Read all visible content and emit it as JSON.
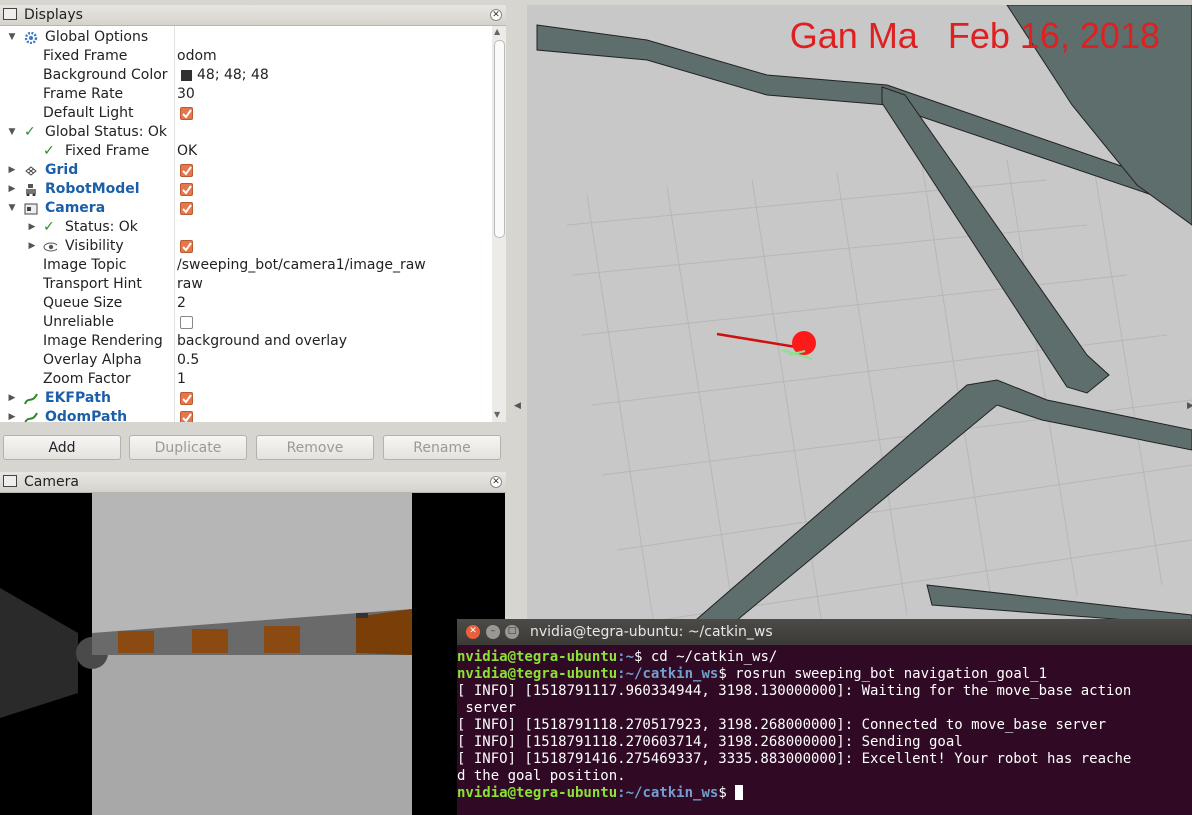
{
  "displays": {
    "title": "Displays",
    "rows": [
      {
        "label": "Global Options"
      },
      {
        "label": "Fixed Frame",
        "value": "odom"
      },
      {
        "label": "Background Color",
        "value": "48; 48; 48"
      },
      {
        "label": "Frame Rate",
        "value": "30"
      },
      {
        "label": "Default Light",
        "checked": true
      },
      {
        "label": "Global Status: Ok"
      },
      {
        "label": "Fixed Frame",
        "value": "OK"
      },
      {
        "label": "Grid",
        "checked": true
      },
      {
        "label": "RobotModel",
        "checked": true
      },
      {
        "label": "Camera",
        "checked": true
      },
      {
        "label": "Status: Ok"
      },
      {
        "label": "Visibility",
        "checked": true
      },
      {
        "label": "Image Topic",
        "value": "/sweeping_bot/camera1/image_raw"
      },
      {
        "label": "Transport Hint",
        "value": "raw"
      },
      {
        "label": "Queue Size",
        "value": "2"
      },
      {
        "label": "Unreliable",
        "checked": false
      },
      {
        "label": "Image Rendering",
        "value": "background and overlay"
      },
      {
        "label": "Overlay Alpha",
        "value": "0.5"
      },
      {
        "label": "Zoom Factor",
        "value": "1"
      },
      {
        "label": "EKFPath",
        "checked": true
      },
      {
        "label": "OdomPath",
        "checked": true
      }
    ]
  },
  "buttons": {
    "add": "Add",
    "duplicate": "Duplicate",
    "remove": "Remove",
    "rename": "Rename"
  },
  "camera_panel": {
    "title": "Camera"
  },
  "view3d": {
    "watermark": "Gan Ma   Feb 16, 2018"
  },
  "terminal": {
    "title": "nvidia@tegra-ubuntu: ~/catkin_ws",
    "lines": [
      {
        "user": "nvidia@tegra-ubuntu",
        "path": ":~",
        "cmd": "$ cd ~/catkin_ws/"
      },
      {
        "user": "nvidia@tegra-ubuntu",
        "path": ":~/catkin_ws",
        "cmd": "$ rosrun sweeping_bot navigation_goal_1"
      },
      {
        "text": "[ INFO] [1518791117.960334944, 3198.130000000]: Waiting for the move_base action"
      },
      {
        "text": " server"
      },
      {
        "text": "[ INFO] [1518791118.270517923, 3198.268000000]: Connected to move_base server"
      },
      {
        "text": "[ INFO] [1518791118.270603714, 3198.268000000]: Sending goal"
      },
      {
        "text": "[ INFO] [1518791416.275469337, 3335.883000000]: Excellent! Your robot has reache"
      },
      {
        "text": "d the goal position."
      },
      {
        "user": "nvidia@tegra-ubuntu",
        "path": ":~/catkin_ws",
        "cmd": "$ "
      }
    ]
  },
  "colors": {
    "accent_checkbox": "#e9764a",
    "watermark": "#e02020",
    "terminal_bg": "#300a24",
    "wall": "#5e6e6d",
    "robot": "#ff1a1a"
  }
}
